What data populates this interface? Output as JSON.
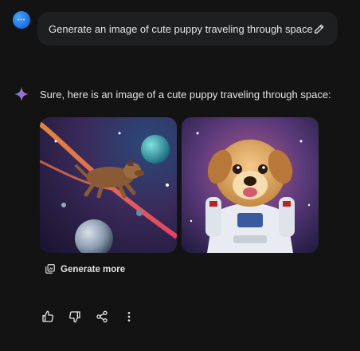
{
  "user": {
    "avatar_text": "•••"
  },
  "prompt": {
    "text": "Generate an image of cute puppy traveling through space"
  },
  "response": {
    "text": "Sure, here is an image of a cute puppy traveling through space:"
  },
  "images": [
    {
      "name": "puppy-flying-through-space"
    },
    {
      "name": "puppy-astronaut-suit"
    }
  ],
  "generate_more": {
    "label": "Generate more"
  },
  "colors": {
    "background": "#131314",
    "bubble": "#1e1f20",
    "text": "#e3e3e3",
    "accent": "#4aa3ff"
  },
  "icons": [
    "edit-icon",
    "sparkle-icon",
    "thumbs-up-icon",
    "thumbs-down-icon",
    "share-icon",
    "more-vert-icon",
    "generate-more-icon"
  ]
}
